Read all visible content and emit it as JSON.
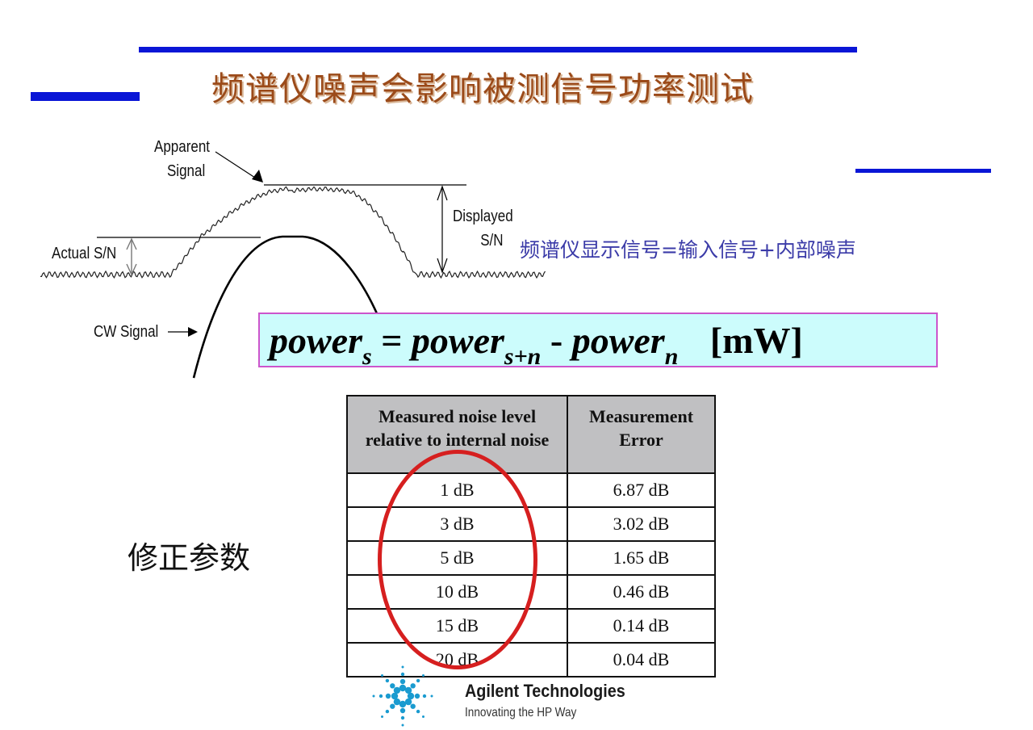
{
  "slide": {
    "title": "频谱仪噪声会影响被测信号功率测试",
    "accent_color": "#0a16d6",
    "title_color": "#9b4a19"
  },
  "diagram": {
    "labels": {
      "apparent_line1": "Apparent",
      "apparent_line2": "Signal",
      "displayed_line1": "Displayed",
      "displayed_line2": "S/N",
      "actual_sn": "Actual S/N",
      "cw_signal": "CW Signal"
    },
    "note": "频谱仪显示信号=输入信号+内部噪声"
  },
  "formula": {
    "lhs": "power",
    "lhs_sub": "s",
    "equals": "=",
    "term1": "power",
    "term1_sub": "s+n",
    "minus": "-",
    "term2": "power",
    "term2_sub": "n",
    "unit": "[mW]"
  },
  "correction": {
    "label": "修正参数",
    "headers": [
      "Measured noise level relative to internal noise",
      "Measurement Error"
    ],
    "rows": [
      [
        "1 dB",
        "6.87 dB"
      ],
      [
        "3 dB",
        "3.02 dB"
      ],
      [
        "5 dB",
        "1.65 dB"
      ],
      [
        "10 dB",
        "0.46 dB"
      ],
      [
        "15 dB",
        "0.14 dB"
      ],
      [
        "20 dB",
        "0.04 dB"
      ]
    ],
    "highlight_color": "#d61f1f"
  },
  "brand": {
    "name": "Agilent Technologies",
    "tagline": "Innovating the HP Way",
    "logo_icon": "agilent-spark-icon",
    "logo_color": "#1a9bd0"
  }
}
